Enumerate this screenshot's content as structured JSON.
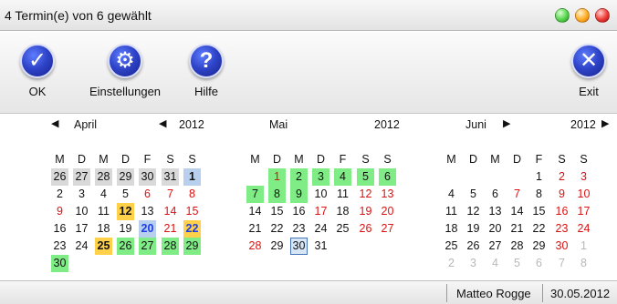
{
  "window": {
    "title": "4 Termin(e) von 6 gewählt",
    "buttons": [
      "green",
      "orange",
      "red"
    ]
  },
  "toolbar": {
    "ok": "OK",
    "settings": "Einstellungen",
    "help": "Hilfe",
    "exit": "Exit"
  },
  "weekdays": [
    "M",
    "D",
    "M",
    "D",
    "F",
    "S",
    "S"
  ],
  "navigation": {
    "prev": "◀",
    "next": "▶"
  },
  "months": [
    {
      "name": "April",
      "year": "2012",
      "days": [
        [
          {
            "text": "26",
            "style": "gray"
          },
          {
            "text": "27",
            "style": "gray"
          },
          {
            "text": "28",
            "style": "gray"
          },
          {
            "text": "29",
            "style": "gray"
          },
          {
            "text": "30",
            "style": "gray"
          },
          {
            "text": "31",
            "style": "gray"
          },
          {
            "text": "1",
            "style": "blue-bold"
          }
        ],
        [
          {
            "text": "2"
          },
          {
            "text": "3"
          },
          {
            "text": "4"
          },
          {
            "text": "5"
          },
          {
            "text": "6",
            "style": "red"
          },
          {
            "text": "7",
            "style": "red"
          },
          {
            "text": "8",
            "style": "red"
          }
        ],
        [
          {
            "text": "9",
            "style": "red"
          },
          {
            "text": "10"
          },
          {
            "text": "11"
          },
          {
            "text": "12",
            "style": "yellow-bold"
          },
          {
            "text": "13"
          },
          {
            "text": "14",
            "style": "red"
          },
          {
            "text": "15",
            "style": "red"
          }
        ],
        [
          {
            "text": "16"
          },
          {
            "text": "17"
          },
          {
            "text": "18"
          },
          {
            "text": "19"
          },
          {
            "text": "20",
            "style": "blue-cell-bold"
          },
          {
            "text": "21",
            "style": "red"
          },
          {
            "text": "22",
            "style": "yellow-bold-blue"
          }
        ],
        [
          {
            "text": "23"
          },
          {
            "text": "24"
          },
          {
            "text": "25",
            "style": "yellow-bold"
          },
          {
            "text": "26",
            "style": "green"
          },
          {
            "text": "27",
            "style": "green"
          },
          {
            "text": "28",
            "style": "green"
          },
          {
            "text": "29",
            "style": "green"
          }
        ],
        [
          {
            "text": "30",
            "style": "green"
          }
        ]
      ]
    },
    {
      "name": "Mai",
      "year": "2012",
      "days": [
        [
          {
            "text": ""
          },
          {
            "text": "1",
            "style": "green-red"
          },
          {
            "text": "2",
            "style": "green"
          },
          {
            "text": "3",
            "style": "green"
          },
          {
            "text": "4",
            "style": "green"
          },
          {
            "text": "5",
            "style": "green"
          },
          {
            "text": "6",
            "style": "green"
          }
        ],
        [
          {
            "text": "7",
            "style": "green"
          },
          {
            "text": "8",
            "style": "green"
          },
          {
            "text": "9",
            "style": "green"
          },
          {
            "text": "10"
          },
          {
            "text": "11"
          },
          {
            "text": "12",
            "style": "red"
          },
          {
            "text": "13",
            "style": "red"
          }
        ],
        [
          {
            "text": "14"
          },
          {
            "text": "15"
          },
          {
            "text": "16"
          },
          {
            "text": "17",
            "style": "red"
          },
          {
            "text": "18"
          },
          {
            "text": "19",
            "style": "red"
          },
          {
            "text": "20",
            "style": "red"
          }
        ],
        [
          {
            "text": "21"
          },
          {
            "text": "22"
          },
          {
            "text": "23"
          },
          {
            "text": "24"
          },
          {
            "text": "25"
          },
          {
            "text": "26",
            "style": "red"
          },
          {
            "text": "27",
            "style": "red"
          }
        ],
        [
          {
            "text": "28",
            "style": "red"
          },
          {
            "text": "29"
          },
          {
            "text": "30",
            "style": "outlined"
          },
          {
            "text": "31"
          }
        ]
      ]
    },
    {
      "name": "Juni",
      "year": "2012",
      "days": [
        [
          {
            "text": ""
          },
          {
            "text": ""
          },
          {
            "text": ""
          },
          {
            "text": ""
          },
          {
            "text": "1"
          },
          {
            "text": "2",
            "style": "red"
          },
          {
            "text": "3",
            "style": "red"
          }
        ],
        [
          {
            "text": "4"
          },
          {
            "text": "5"
          },
          {
            "text": "6"
          },
          {
            "text": "7",
            "style": "red"
          },
          {
            "text": "8"
          },
          {
            "text": "9",
            "style": "red"
          },
          {
            "text": "10",
            "style": "red"
          }
        ],
        [
          {
            "text": "11"
          },
          {
            "text": "12"
          },
          {
            "text": "13"
          },
          {
            "text": "14"
          },
          {
            "text": "15"
          },
          {
            "text": "16",
            "style": "red"
          },
          {
            "text": "17",
            "style": "red"
          }
        ],
        [
          {
            "text": "18"
          },
          {
            "text": "19"
          },
          {
            "text": "20"
          },
          {
            "text": "21"
          },
          {
            "text": "22"
          },
          {
            "text": "23",
            "style": "red"
          },
          {
            "text": "24",
            "style": "red"
          }
        ],
        [
          {
            "text": "25"
          },
          {
            "text": "26"
          },
          {
            "text": "27"
          },
          {
            "text": "28"
          },
          {
            "text": "29"
          },
          {
            "text": "30",
            "style": "red"
          },
          {
            "text": "1",
            "style": "light"
          }
        ],
        [
          {
            "text": "2",
            "style": "light"
          },
          {
            "text": "3",
            "style": "light"
          },
          {
            "text": "4",
            "style": "light"
          },
          {
            "text": "5",
            "style": "light"
          },
          {
            "text": "6",
            "style": "light"
          },
          {
            "text": "7",
            "style": "light"
          },
          {
            "text": "8",
            "style": "light"
          }
        ]
      ]
    }
  ],
  "status": {
    "user": "Matteo Rogge",
    "date": "30.05.2012"
  },
  "colors": {
    "accent": "#2f46c8",
    "selected_green": "#80ec86",
    "highlight_yellow": "#ffd04a",
    "weekend_red": "#d11111"
  }
}
